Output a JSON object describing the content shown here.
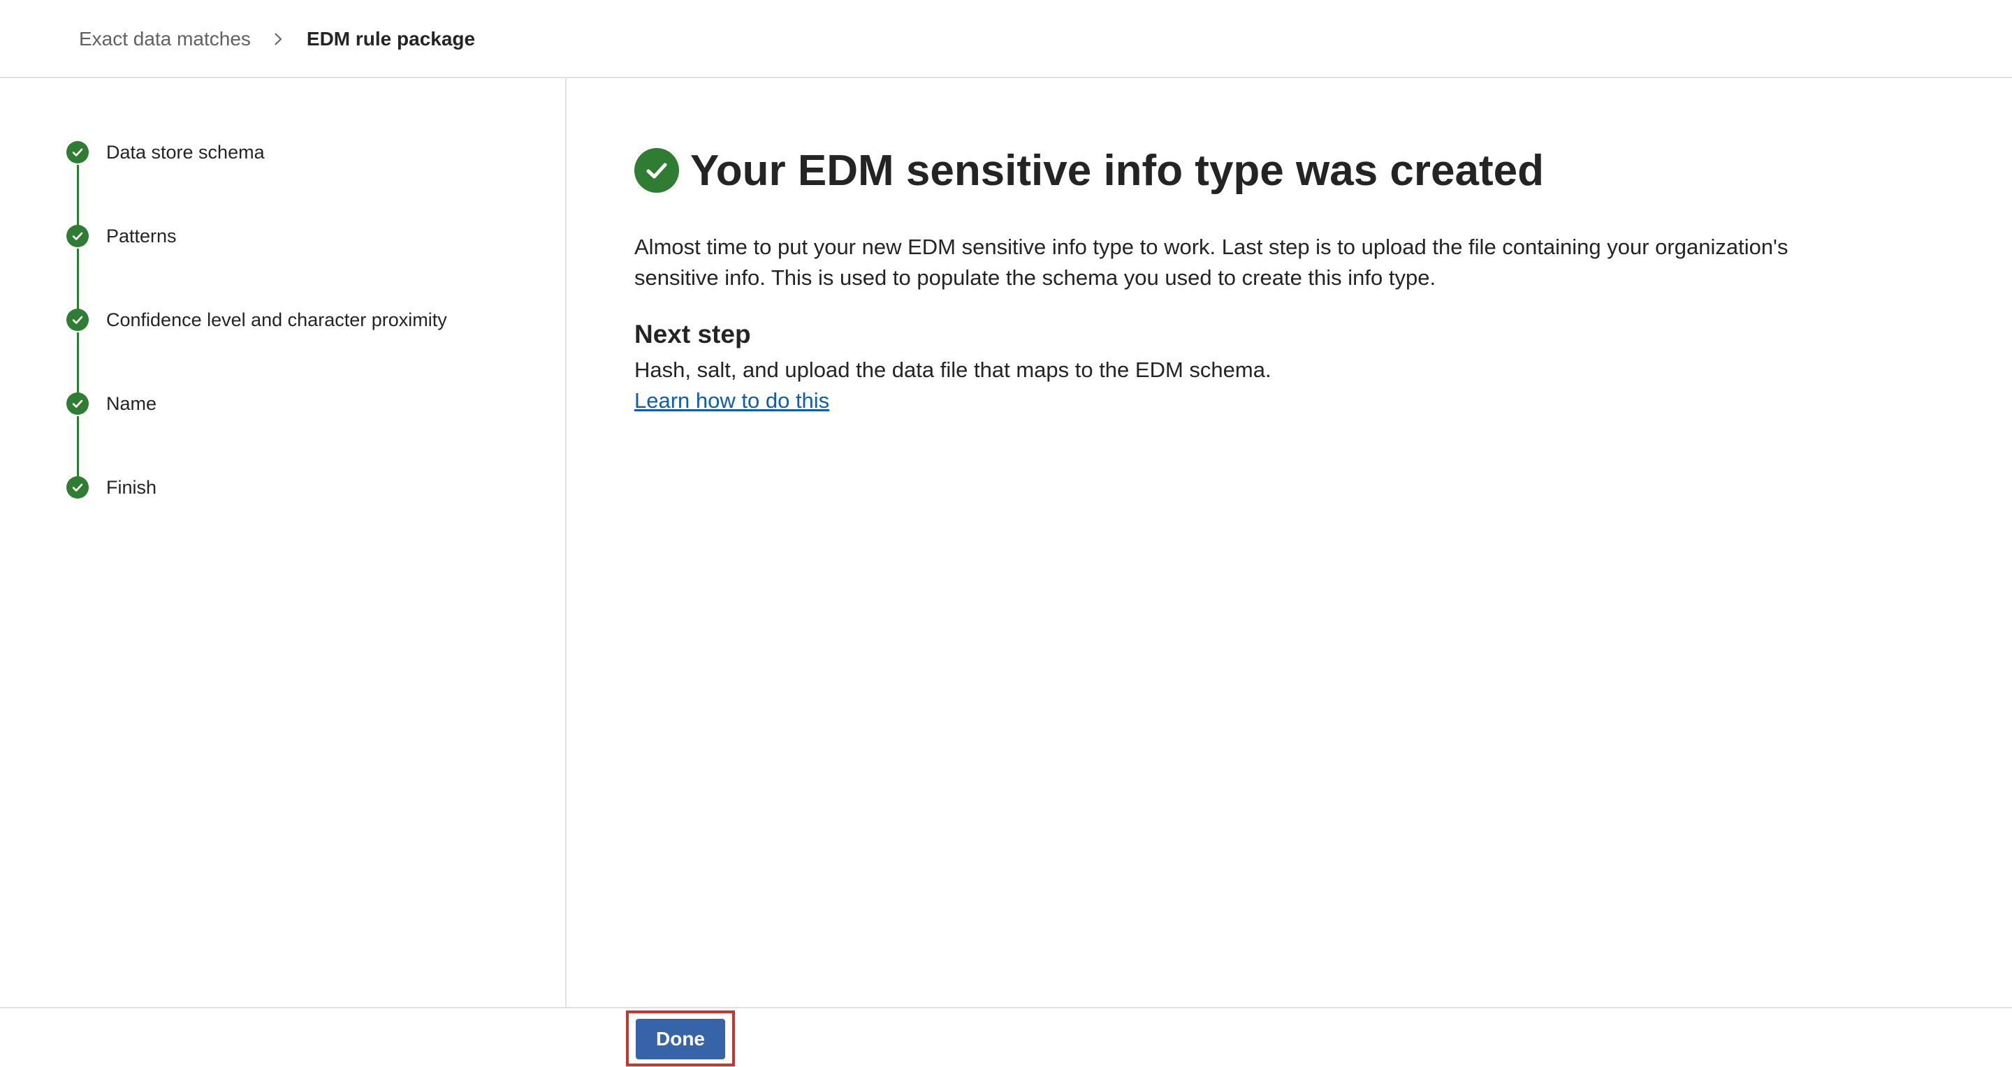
{
  "breadcrumb": {
    "parent": "Exact data matches",
    "current": "EDM rule package"
  },
  "steps": [
    {
      "label": "Data store schema",
      "status": "completed"
    },
    {
      "label": "Patterns",
      "status": "completed"
    },
    {
      "label": "Confidence level and character proximity",
      "status": "completed"
    },
    {
      "label": "Name",
      "status": "completed"
    },
    {
      "label": "Finish",
      "status": "completed"
    }
  ],
  "main": {
    "title": "Your EDM sensitive info type was created",
    "description": "Almost time to put your new EDM sensitive info type to work. Last step is to upload the file containing your organization's sensitive info. This is used to populate the schema you used to create this info type.",
    "next_step_heading": "Next step",
    "next_step_text": "Hash, salt, and upload the data file that maps to the EDM schema.",
    "learn_link": "Learn how to do this"
  },
  "footer": {
    "done_label": "Done"
  },
  "colors": {
    "success": "#2e7d32",
    "primary_button": "#3763a8",
    "link": "#0f5ea8",
    "highlight": "#c8372d"
  },
  "icons": {
    "breadcrumb_separator": "chevron-right-icon",
    "step_status": "checkmark-circle-icon",
    "title_status": "checkmark-circle-icon"
  }
}
